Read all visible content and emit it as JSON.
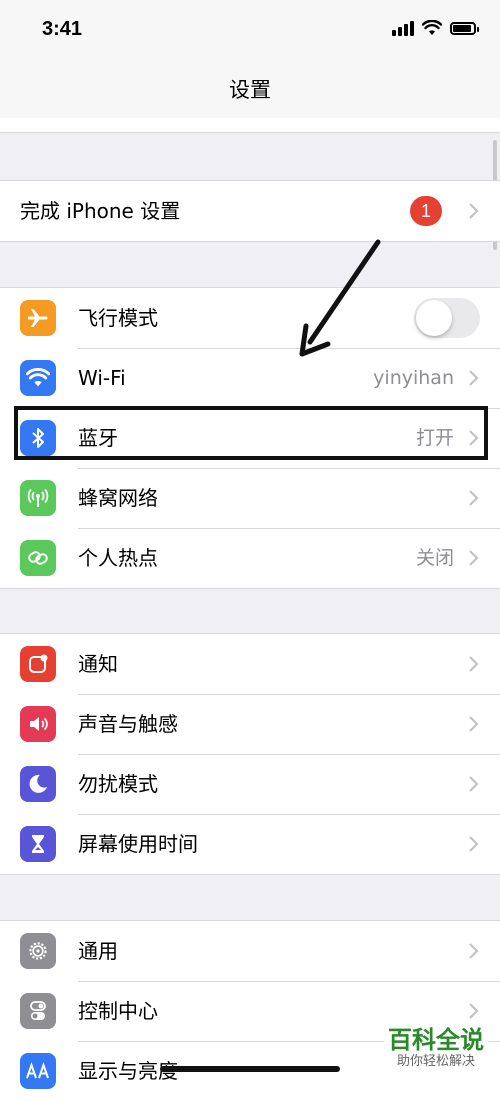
{
  "status": {
    "time": "3:41"
  },
  "nav": {
    "title": "设置"
  },
  "setup": {
    "label": "完成 iPhone 设置",
    "badge": "1"
  },
  "network": {
    "airplane": {
      "label": "飞行模式",
      "toggle_on": false
    },
    "wifi": {
      "label": "Wi-Fi",
      "value": "yinyihan"
    },
    "bluetooth": {
      "label": "蓝牙",
      "value": "打开"
    },
    "cellular": {
      "label": "蜂窝网络"
    },
    "hotspot": {
      "label": "个人热点",
      "value": "关闭"
    }
  },
  "notif_group": {
    "notifications": {
      "label": "通知"
    },
    "sounds": {
      "label": "声音与触感"
    },
    "dnd": {
      "label": "勿扰模式"
    },
    "screentime": {
      "label": "屏幕使用时间"
    }
  },
  "general_group": {
    "general": {
      "label": "通用"
    },
    "control": {
      "label": "控制中心"
    },
    "display": {
      "label": "显示与亮度"
    }
  },
  "icons": {
    "airplane": "airplane-icon",
    "wifi": "wifi-icon",
    "bluetooth": "bluetooth-icon",
    "cellular": "cellular-antenna-icon",
    "hotspot": "hotspot-link-icon",
    "notifications": "notifications-icon",
    "sounds": "speaker-icon",
    "dnd": "moon-icon",
    "screentime": "hourglass-icon",
    "general": "gear-icon",
    "control": "toggles-icon",
    "display": "text-size-icon"
  },
  "colors": {
    "airplane": "#f59a23",
    "wifi": "#3478f6",
    "bluetooth": "#3478f6",
    "cellular": "#5ac85a",
    "hotspot": "#5ac85a",
    "notifications": "#e64032",
    "sounds": "#e53a55",
    "dnd": "#5856d6",
    "screentime": "#5856d6",
    "general": "#8e8e93",
    "control": "#8e8e93",
    "display": "#3478f6",
    "badge": "#e64032"
  },
  "watermark": {
    "brand": "百科全说",
    "sub": "助你轻松解决"
  }
}
